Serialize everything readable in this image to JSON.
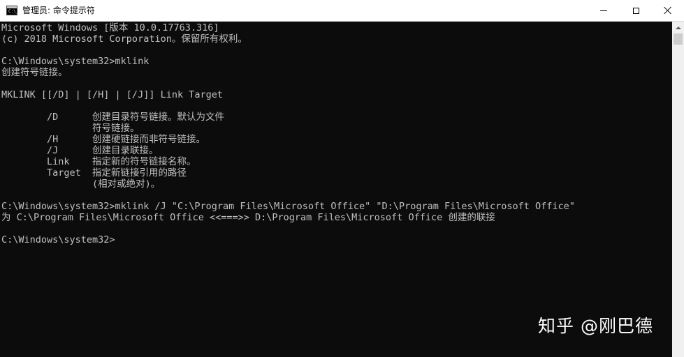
{
  "window": {
    "title": "管理员: 命令提示符",
    "icon": "cmd-icon",
    "icon_prompt": "C:\\_",
    "controls": {
      "minimize": "minimize-icon",
      "maximize": "maximize-icon",
      "close": "close-icon"
    }
  },
  "console": {
    "lines": [
      "Microsoft Windows [版本 10.0.17763.316]",
      "(c) 2018 Microsoft Corporation。保留所有权利。",
      "",
      "C:\\Windows\\system32>mklink",
      "创建符号链接。",
      "",
      "MKLINK [[/D] | [/H] | [/J]] Link Target",
      "",
      "        /D      创建目录符号链接。默认为文件",
      "                符号链接。",
      "        /H      创建硬链接而非符号链接。",
      "        /J      创建目录联接。",
      "        Link    指定新的符号链接名称。",
      "        Target  指定新链接引用的路径",
      "                (相对或绝对)。",
      "",
      "C:\\Windows\\system32>mklink /J \"C:\\Program Files\\Microsoft Office\" \"D:\\Program Files\\Microsoft Office\"",
      "为 C:\\Program Files\\Microsoft Office <<===>> D:\\Program Files\\Microsoft Office 创建的联接",
      "",
      "C:\\Windows\\system32>"
    ]
  },
  "watermark": {
    "text": "知乎 @刚巴德"
  },
  "colors": {
    "console_bg": "#0c0c0c",
    "console_text": "#c0c0c0",
    "titlebar_bg": "#ffffff",
    "scrollbar_bg": "#f0f0f0"
  }
}
